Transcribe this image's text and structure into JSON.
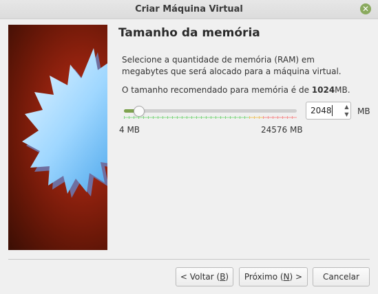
{
  "window": {
    "title": "Criar Máquina Virtual"
  },
  "titlebar": {
    "close_icon": "close-icon",
    "close_color": "#8aaa5e"
  },
  "banner": {
    "icon": "starburst-icon"
  },
  "page": {
    "heading": "Tamanho da memória",
    "description": "Selecione a quantidade de memória (RAM) em megabytes que será alocado para a máquina virtual.",
    "recommend_prefix": "O tamanho recomendado para memória é de ",
    "recommend_value": "1024",
    "recommend_suffix": "MB."
  },
  "memory": {
    "value": "2048",
    "unit": "MB",
    "min_label": "4 MB",
    "max_label": "24576 MB",
    "min": 4,
    "max": 24576,
    "current": 2048
  },
  "buttons": {
    "back_prefix": "< Voltar (",
    "back_key": "B",
    "back_suffix": ")",
    "next_prefix": "Próximo (",
    "next_key": "N",
    "next_suffix": ") >",
    "cancel": "Cancelar"
  }
}
